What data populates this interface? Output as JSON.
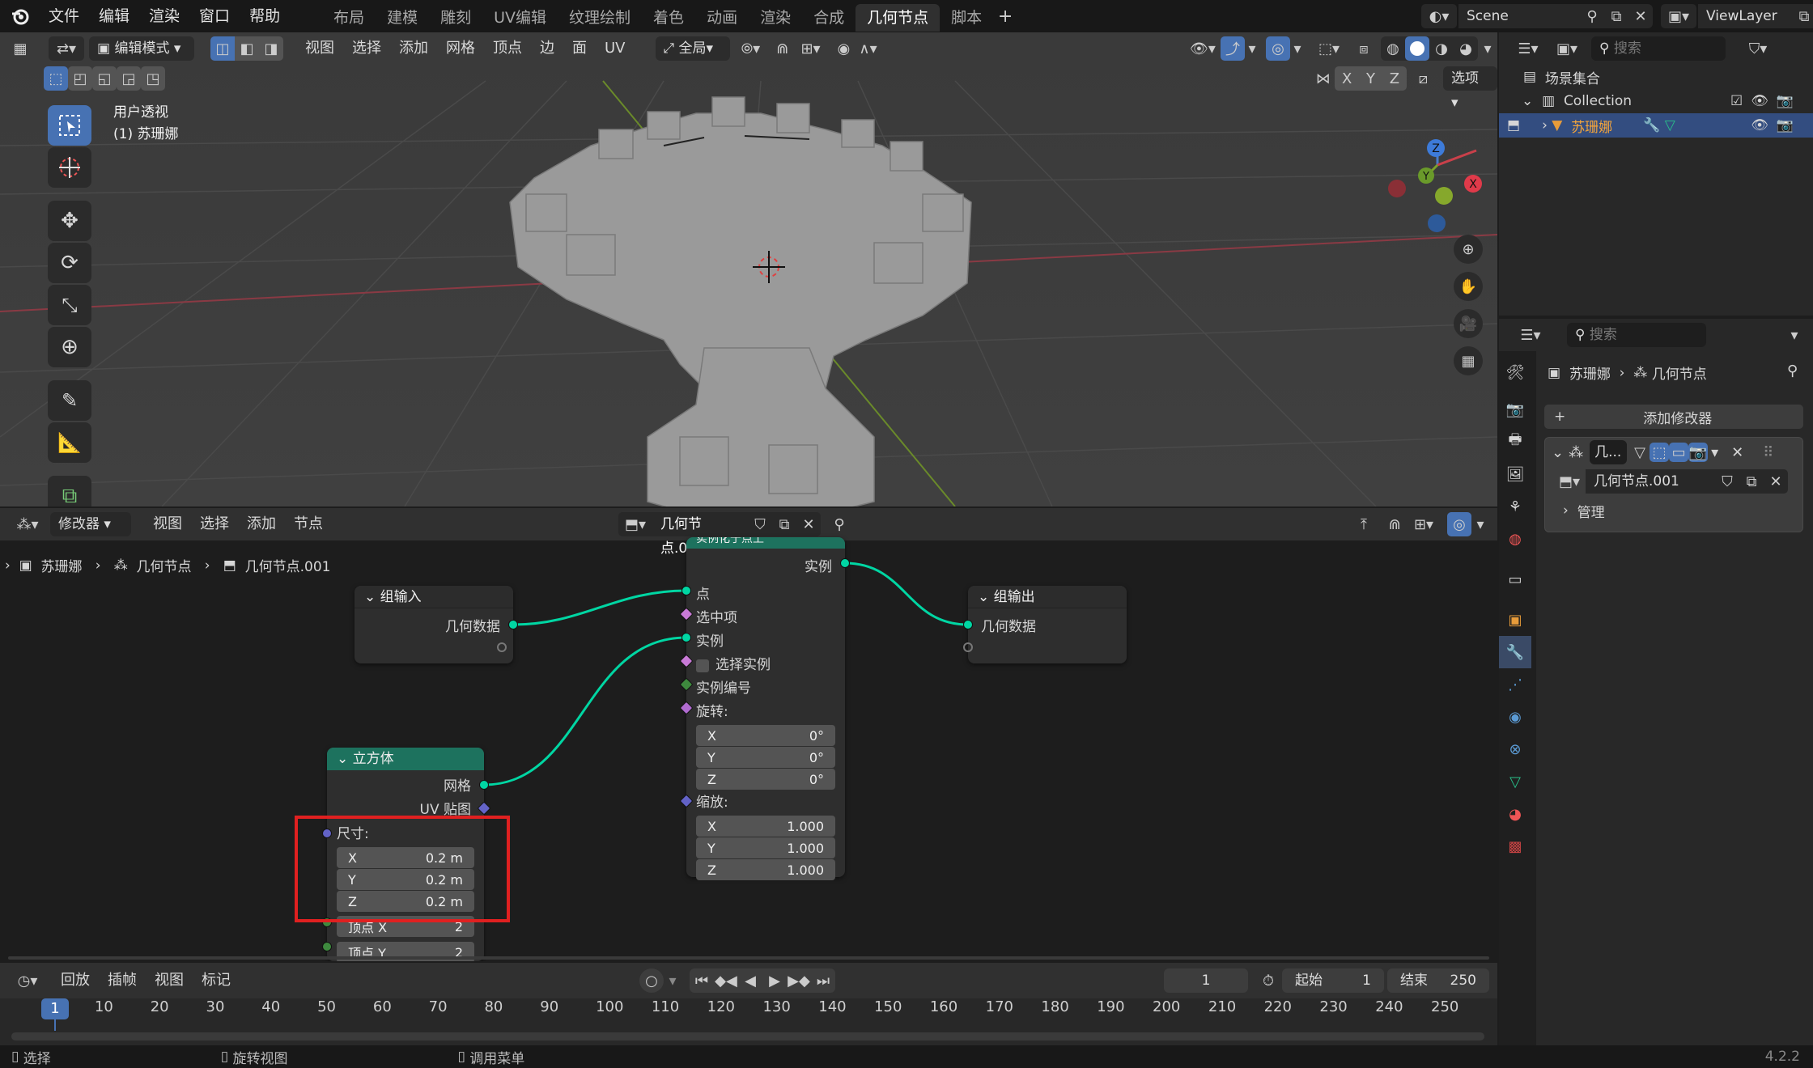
{
  "topbar": {
    "menus": [
      "文件",
      "编辑",
      "渲染",
      "窗口",
      "帮助"
    ],
    "workspaces": [
      "布局",
      "建模",
      "雕刻",
      "UV编辑",
      "纹理绘制",
      "着色",
      "动画",
      "渲染",
      "合成",
      "几何节点",
      "脚本"
    ],
    "active_workspace": "几何节点",
    "scene": "Scene",
    "view_layer": "ViewLayer"
  },
  "viewport": {
    "mode": "编辑模式",
    "menus": [
      "视图",
      "选择",
      "添加",
      "网格",
      "顶点",
      "边",
      "面",
      "UV"
    ],
    "transform_orientation": "全局",
    "overlay_title": "用户透视",
    "overlay_object": "(1) 苏珊娜",
    "axis_labels": [
      "X",
      "Y",
      "Z"
    ],
    "options_label": "选项",
    "gizmo": {
      "x": "X",
      "y": "Y",
      "z": "Z"
    }
  },
  "node_editor": {
    "editor_type": "修改器",
    "menus": [
      "视图",
      "选择",
      "添加",
      "节点"
    ],
    "node_group": "几何节点.001",
    "breadcrumb": [
      "苏珊娜",
      "几何节点",
      "几何节点.001"
    ],
    "group_input": {
      "title": "组输入",
      "output": "几何数据"
    },
    "group_output": {
      "title": "组输出",
      "input": "几何数据"
    },
    "instance_node": {
      "title": "实例化于点上",
      "output": "实例",
      "inputs": [
        "点",
        "选中项",
        "实例",
        "选择实例",
        "实例编号"
      ],
      "rotation_label": "旋转:",
      "rotation": [
        {
          "axis": "X",
          "value": "0°"
        },
        {
          "axis": "Y",
          "value": "0°"
        },
        {
          "axis": "Z",
          "value": "0°"
        }
      ],
      "scale_label": "缩放:",
      "scale": [
        {
          "axis": "X",
          "value": "1.000"
        },
        {
          "axis": "Y",
          "value": "1.000"
        },
        {
          "axis": "Z",
          "value": "1.000"
        }
      ]
    },
    "cube_node": {
      "title": "立方体",
      "outputs": [
        "网格",
        "UV 贴图"
      ],
      "size_label": "尺寸:",
      "size": [
        {
          "axis": "X",
          "value": "0.2 m"
        },
        {
          "axis": "Y",
          "value": "0.2 m"
        },
        {
          "axis": "Z",
          "value": "0.2 m"
        }
      ],
      "vertices": [
        {
          "label": "顶点 X",
          "value": "2"
        },
        {
          "label": "顶点 Y",
          "value": "2"
        }
      ]
    }
  },
  "timeline": {
    "menus": [
      "回放",
      "插帧",
      "视图",
      "标记"
    ],
    "current_frame": "1",
    "start_label": "起始",
    "start": "1",
    "end_label": "结束",
    "end": "250",
    "ticks": [
      "1",
      "10",
      "20",
      "30",
      "40",
      "50",
      "60",
      "70",
      "80",
      "90",
      "100",
      "110",
      "120",
      "130",
      "140",
      "150",
      "160",
      "170",
      "180",
      "190",
      "200",
      "210",
      "220",
      "230",
      "240",
      "250"
    ]
  },
  "outliner": {
    "search_placeholder": "搜索",
    "scene_collection": "场景集合",
    "collection": "Collection",
    "object": "苏珊娜"
  },
  "properties": {
    "search_placeholder": "搜索",
    "breadcrumb_object": "苏珊娜",
    "breadcrumb_modifier": "几何节点",
    "add_modifier": "添加修改器",
    "modifier_name": "几...",
    "node_group": "几何节点.001",
    "manage": "管理"
  },
  "statusbar": {
    "select": "选择",
    "rotate": "旋转视图",
    "menu": "调用菜单",
    "version": "4.2.2"
  },
  "colors": {
    "accent": "#4772b3",
    "geometry_socket": "#00d6a3",
    "node_green": "#1d725e",
    "highlight_box": "#e02020"
  }
}
